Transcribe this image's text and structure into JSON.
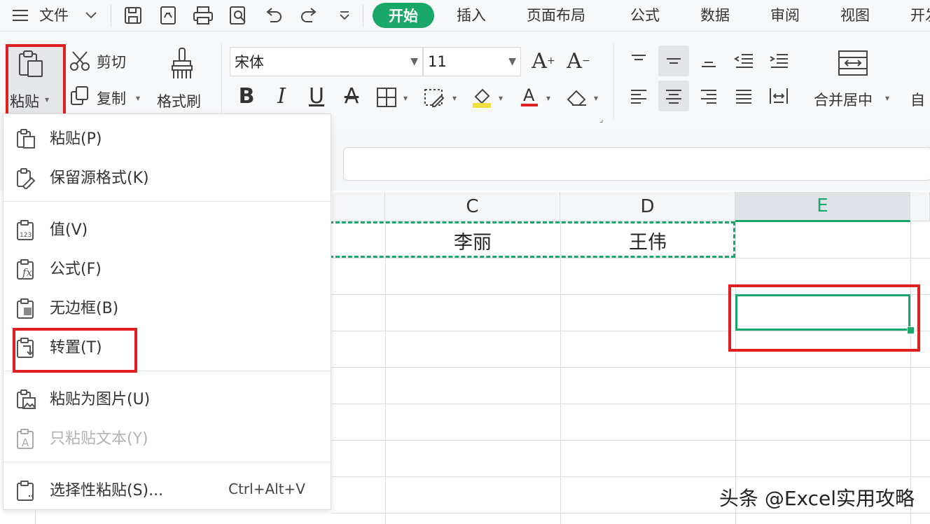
{
  "menubar": {
    "file_label": "文件",
    "tabs": [
      "开始",
      "插入",
      "页面布局",
      "公式",
      "数据",
      "审阅",
      "视图",
      "开发"
    ],
    "active_tab": "开始"
  },
  "ribbon": {
    "paste_label": "粘贴",
    "cut_label": "剪切",
    "copy_label": "复制",
    "format_painter_label": "格式刷",
    "font_name": "宋体",
    "font_size": "11",
    "merge_center_label": "合并居中",
    "auto_wrap_label": "自"
  },
  "sheet": {
    "columns": [
      "C",
      "D",
      "E"
    ],
    "selected_column": "E",
    "cells": {
      "C1": "李丽",
      "D1": "王伟"
    }
  },
  "paste_menu": {
    "items": [
      {
        "label": "粘贴(P)",
        "icon": "paste-icon"
      },
      {
        "label": "保留源格式(K)",
        "icon": "keep-source-format-icon"
      },
      {
        "label": "值(V)",
        "icon": "paste-values-icon"
      },
      {
        "label": "公式(F)",
        "icon": "paste-formula-icon"
      },
      {
        "label": "无边框(B)",
        "icon": "paste-no-border-icon"
      },
      {
        "label": "转置(T)",
        "icon": "transpose-icon"
      },
      {
        "label": "粘贴为图片(U)",
        "icon": "paste-as-picture-icon"
      },
      {
        "label": "只粘贴文本(Y)",
        "icon": "paste-text-only-icon",
        "disabled": true
      },
      {
        "label": "选择性粘贴(S)...",
        "icon": "paste-special-icon",
        "shortcut": "Ctrl+Alt+V"
      }
    ]
  },
  "watermark": "头条 @Excel实用攻略",
  "colors": {
    "accent": "#1aa86a",
    "highlight_red": "#e02020"
  }
}
